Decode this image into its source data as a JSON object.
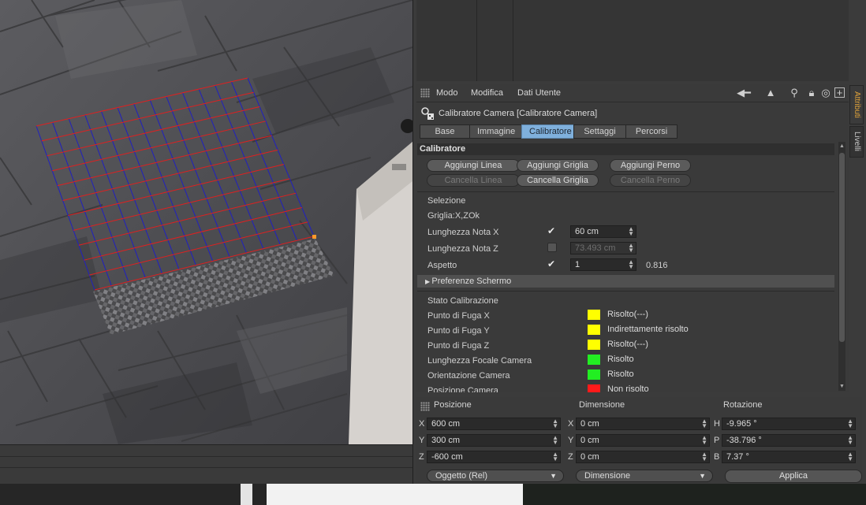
{
  "attributes": {
    "menu": [
      "Modo",
      "Modifica",
      "Dati Utente"
    ],
    "object_title": "Calibratore Camera [Calibratore Camera]",
    "tabs": [
      {
        "label": "Base",
        "active": false
      },
      {
        "label": "Immagine",
        "active": false
      },
      {
        "label": "Calibratore",
        "active": true
      },
      {
        "label": "Settaggi",
        "active": false
      },
      {
        "label": "Percorsi",
        "active": false
      }
    ],
    "section_title": "Calibratore",
    "buttons": {
      "add_line": "Aggiungi Linea",
      "add_grid": "Aggiungi Griglia",
      "add_pin": "Aggiungi Perno",
      "del_line": "Cancella Linea",
      "del_grid": "Cancella Griglia",
      "del_pin": "Cancella Perno"
    },
    "selection": {
      "title": "Selezione",
      "grid_info": "Griglia:X,ZOk",
      "known_length_x": {
        "label": "Lunghezza Nota X",
        "checked": true,
        "value": "60 cm"
      },
      "known_length_z": {
        "label": "Lunghezza Nota Z",
        "checked": false,
        "value": "73.493 cm"
      },
      "aspect": {
        "label": "Aspetto",
        "checked": true,
        "value": "1",
        "ratio": "0.816"
      }
    },
    "screen_prefs": "Preferenze Schermo",
    "calibration": {
      "title": "Stato Calibrazione",
      "items": [
        {
          "label": "Punto di Fuga X",
          "status": "Risolto(---)",
          "color": "#ffff00"
        },
        {
          "label": "Punto di Fuga Y",
          "status": "Indirettamente risolto",
          "color": "#ffff00"
        },
        {
          "label": "Punto di Fuga Z",
          "status": "Risolto(---)",
          "color": "#ffff00"
        },
        {
          "label": "Lunghezza Focale Camera",
          "status": "Risolto",
          "color": "#22ee22"
        },
        {
          "label": "Orientazione Camera",
          "status": "Risolto",
          "color": "#22ee22"
        },
        {
          "label": "Posizione Camera",
          "status": "Non risolto",
          "color": "#ff1a1a"
        }
      ]
    },
    "side_tabs": [
      "Attributi",
      "Livelli"
    ]
  },
  "coordinates": {
    "headers": [
      "Posizione",
      "Dimensione",
      "Rotazione"
    ],
    "position": [
      {
        "axis": "X",
        "value": "600 cm"
      },
      {
        "axis": "Y",
        "value": "300 cm"
      },
      {
        "axis": "Z",
        "value": "-600 cm"
      }
    ],
    "size": [
      {
        "axis": "X",
        "value": "0 cm"
      },
      {
        "axis": "Y",
        "value": "0 cm"
      },
      {
        "axis": "Z",
        "value": "0 cm"
      }
    ],
    "rotation": [
      {
        "axis": "H",
        "value": "-9.965 °"
      },
      {
        "axis": "P",
        "value": "-38.796 °"
      },
      {
        "axis": "B",
        "value": "7.37 °"
      }
    ],
    "mode_select": "Oggetto (Rel)",
    "size_select": "Dimensione",
    "apply_label": "Applica"
  },
  "colors": {
    "accent_tab": "#7fb0dc",
    "side_tab_active": "#e0a33a",
    "grid_red": "#e02020",
    "grid_blue": "#2020c0"
  }
}
